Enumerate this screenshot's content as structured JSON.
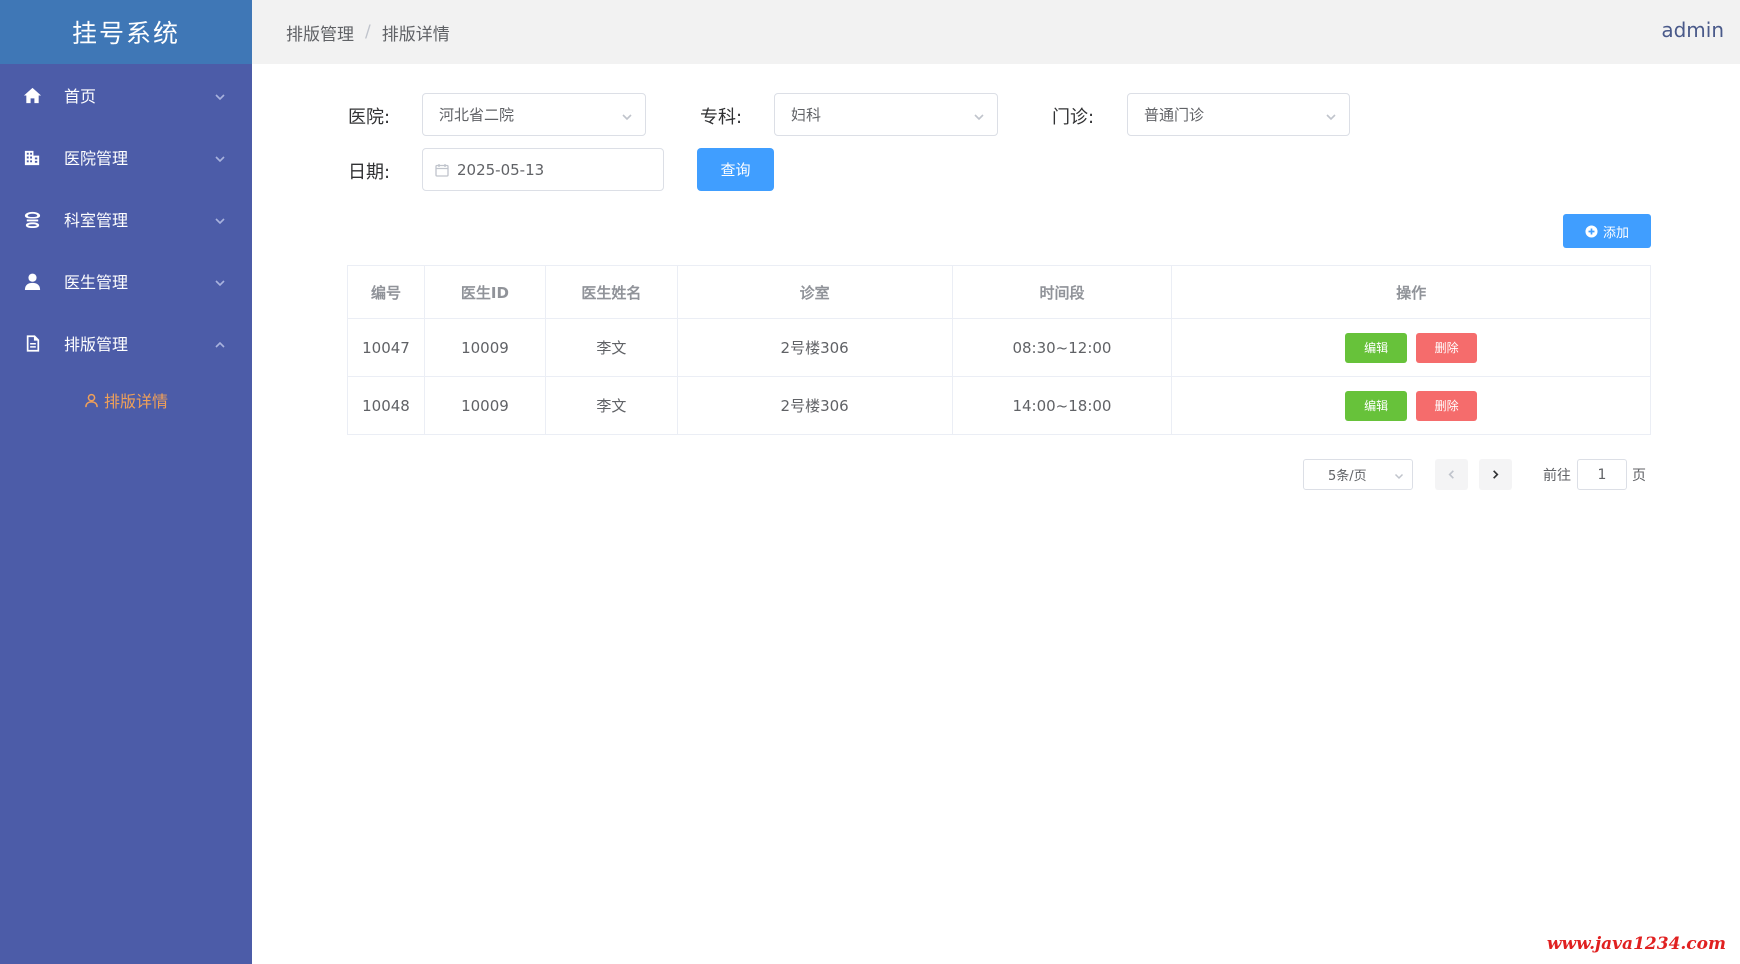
{
  "app": {
    "title": "挂号系统",
    "user": "admin"
  },
  "sidebar": {
    "items": [
      {
        "label": "首页",
        "icon": "home-icon"
      },
      {
        "label": "医院管理",
        "icon": "building-icon"
      },
      {
        "label": "科室管理",
        "icon": "department-icon"
      },
      {
        "label": "医生管理",
        "icon": "user-icon"
      },
      {
        "label": "排版管理",
        "icon": "document-icon"
      }
    ],
    "sub_item": {
      "label": "排版详情",
      "icon": "user-outline-icon"
    }
  },
  "breadcrumb": {
    "parent": "排版管理",
    "separator": "/",
    "current": "排版详情"
  },
  "form": {
    "hospital_label": "医院:",
    "hospital_value": "河北省二院",
    "specialty_label": "专科:",
    "specialty_value": "妇科",
    "clinic_label": "门诊:",
    "clinic_value": "普通门诊",
    "date_label": "日期:",
    "date_value": "2025-05-13",
    "query_label": "查询"
  },
  "toolbar": {
    "add_label": "添加"
  },
  "table": {
    "headers": [
      "编号",
      "医生ID",
      "医生姓名",
      "诊室",
      "时间段",
      "操作"
    ],
    "rows": [
      {
        "id": "10047",
        "doctor_id": "10009",
        "doctor_name": "李文",
        "room": "2号楼306",
        "time": "08:30~12:00"
      },
      {
        "id": "10048",
        "doctor_id": "10009",
        "doctor_name": "李文",
        "room": "2号楼306",
        "time": "14:00~18:00"
      }
    ],
    "edit_label": "编辑",
    "delete_label": "删除"
  },
  "pagination": {
    "page_size": "5条/页",
    "goto_label": "前往",
    "page": "1",
    "page_unit": "页"
  },
  "watermark": "www.java1234.com",
  "colors": {
    "sidebar": "#4c5ca8",
    "logo": "#3f77b6",
    "primary": "#409eff",
    "success": "#67c23a",
    "danger": "#f56c6c",
    "active_sub": "#f0a058"
  }
}
